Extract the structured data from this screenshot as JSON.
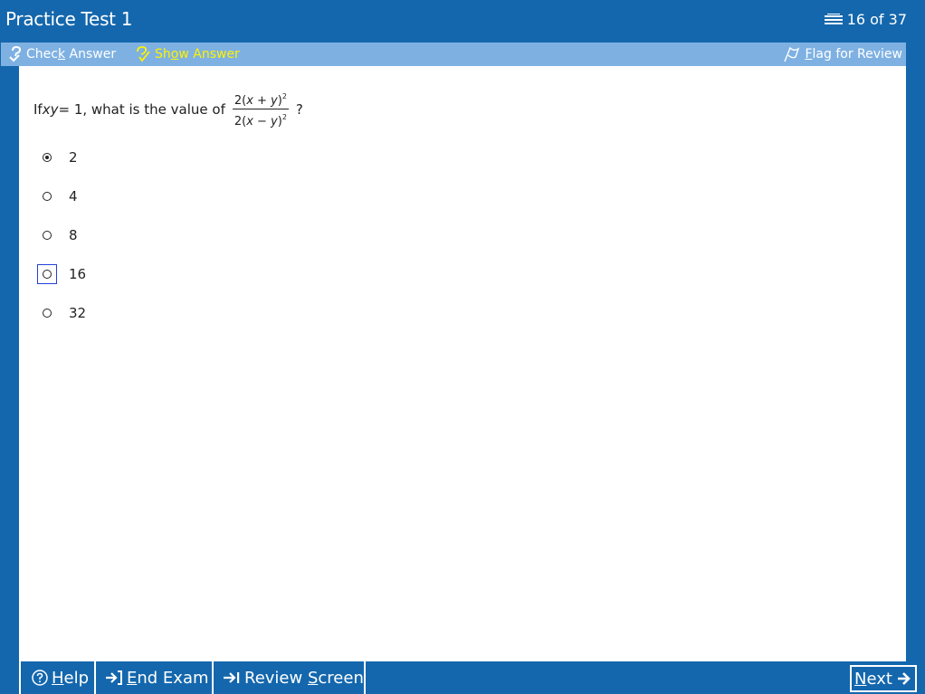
{
  "window": {
    "title": "Practice Test 1",
    "counter": "16 of 37"
  },
  "toolbar": {
    "check_label_pre": "Chec",
    "check_label_key": "k",
    "check_label_post": " Answer",
    "show_label_pre": "Sh",
    "show_label_key": "o",
    "show_label_post": "w Answer",
    "flag_label_key": "F",
    "flag_label_post": "lag for Review"
  },
  "question": {
    "prefix": "If ",
    "var": "xy",
    "middle": " = 1, what is the value of",
    "numerator_pre": "2(",
    "numerator_var": "x + y",
    "numerator_post": ")",
    "numerator_exp": "2",
    "denominator_pre": "2(",
    "denominator_var": "x − y",
    "denominator_post": ")",
    "denominator_exp": "2",
    "suffix": "?"
  },
  "choices": [
    {
      "label": "2",
      "selected": true
    },
    {
      "label": "4",
      "selected": false
    },
    {
      "label": "8",
      "selected": false
    },
    {
      "label": "16",
      "selected": false
    },
    {
      "label": "32",
      "selected": false
    }
  ],
  "bottombar": {
    "help_key": "H",
    "help_post": "elp",
    "end_key": "E",
    "end_post": "nd Exam",
    "review_pre": "Review ",
    "review_key": "S",
    "review_post": "creen",
    "next_key": "N",
    "next_post": "ext"
  },
  "colors": {
    "chrome": "#1467ad",
    "toolbar": "#7eb1e2",
    "show_answer": "#fff200",
    "focus": "#2340d8"
  }
}
